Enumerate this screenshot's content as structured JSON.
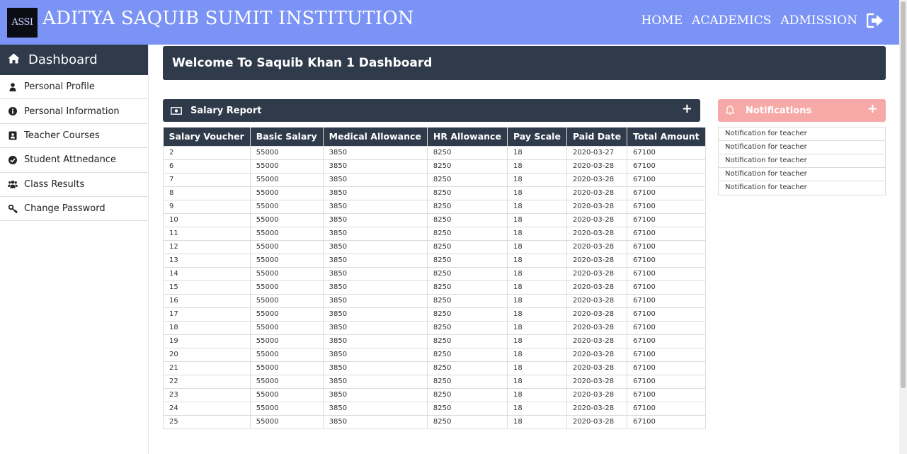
{
  "header": {
    "logo_text": "ASSI",
    "brand": "ADITYA SAQUIB SUMIT INSTITUTION",
    "nav": [
      "HOME",
      "ACADEMICS",
      "ADMISSION"
    ],
    "logout_icon": "sign-out-icon",
    "bg_color": "#7b93f5"
  },
  "sidebar": {
    "title": "Dashboard",
    "title_icon": "home-icon",
    "items": [
      {
        "label": "Personal Profile",
        "icon": "user-icon"
      },
      {
        "label": "Personal Information",
        "icon": "info-circle-icon"
      },
      {
        "label": "Teacher Courses",
        "icon": "address-book-icon"
      },
      {
        "label": "Student Attnedance",
        "icon": "check-circle-icon"
      },
      {
        "label": "Class Results",
        "icon": "users-icon"
      },
      {
        "label": "Change Password",
        "icon": "key-icon"
      }
    ]
  },
  "welcome": "Welcome To Saquib Khan 1 Dashboard",
  "salary": {
    "title": "Salary Report",
    "icon": "money-bill-icon",
    "add_icon": "+",
    "columns": [
      "Salary Voucher",
      "Basic Salary",
      "Medical Allowance",
      "HR Allowance",
      "Pay Scale",
      "Paid Date",
      "Total Amount"
    ],
    "rows": [
      [
        "2",
        "55000",
        "3850",
        "8250",
        "18",
        "2020-03-27",
        "67100"
      ],
      [
        "6",
        "55000",
        "3850",
        "8250",
        "18",
        "2020-03-28",
        "67100"
      ],
      [
        "7",
        "55000",
        "3850",
        "8250",
        "18",
        "2020-03-28",
        "67100"
      ],
      [
        "8",
        "55000",
        "3850",
        "8250",
        "18",
        "2020-03-28",
        "67100"
      ],
      [
        "9",
        "55000",
        "3850",
        "8250",
        "18",
        "2020-03-28",
        "67100"
      ],
      [
        "10",
        "55000",
        "3850",
        "8250",
        "18",
        "2020-03-28",
        "67100"
      ],
      [
        "11",
        "55000",
        "3850",
        "8250",
        "18",
        "2020-03-28",
        "67100"
      ],
      [
        "12",
        "55000",
        "3850",
        "8250",
        "18",
        "2020-03-28",
        "67100"
      ],
      [
        "13",
        "55000",
        "3850",
        "8250",
        "18",
        "2020-03-28",
        "67100"
      ],
      [
        "14",
        "55000",
        "3850",
        "8250",
        "18",
        "2020-03-28",
        "67100"
      ],
      [
        "15",
        "55000",
        "3850",
        "8250",
        "18",
        "2020-03-28",
        "67100"
      ],
      [
        "16",
        "55000",
        "3850",
        "8250",
        "18",
        "2020-03-28",
        "67100"
      ],
      [
        "17",
        "55000",
        "3850",
        "8250",
        "18",
        "2020-03-28",
        "67100"
      ],
      [
        "18",
        "55000",
        "3850",
        "8250",
        "18",
        "2020-03-28",
        "67100"
      ],
      [
        "19",
        "55000",
        "3850",
        "8250",
        "18",
        "2020-03-28",
        "67100"
      ],
      [
        "20",
        "55000",
        "3850",
        "8250",
        "18",
        "2020-03-28",
        "67100"
      ],
      [
        "21",
        "55000",
        "3850",
        "8250",
        "18",
        "2020-03-28",
        "67100"
      ],
      [
        "22",
        "55000",
        "3850",
        "8250",
        "18",
        "2020-03-28",
        "67100"
      ],
      [
        "23",
        "55000",
        "3850",
        "8250",
        "18",
        "2020-03-28",
        "67100"
      ],
      [
        "24",
        "55000",
        "3850",
        "8250",
        "18",
        "2020-03-28",
        "67100"
      ],
      [
        "25",
        "55000",
        "3850",
        "8250",
        "18",
        "2020-03-28",
        "67100"
      ]
    ]
  },
  "notifications": {
    "title": "Notifications",
    "icon": "bell-icon",
    "add_icon": "+",
    "items": [
      "Notification for teacher",
      "Notification for teacher",
      "Notification for teacher",
      "Notification for teacher",
      "Notification for teacher"
    ]
  },
  "colors": {
    "dark_panel": "#2f3b4b",
    "notif_header": "#f7a9a7"
  }
}
